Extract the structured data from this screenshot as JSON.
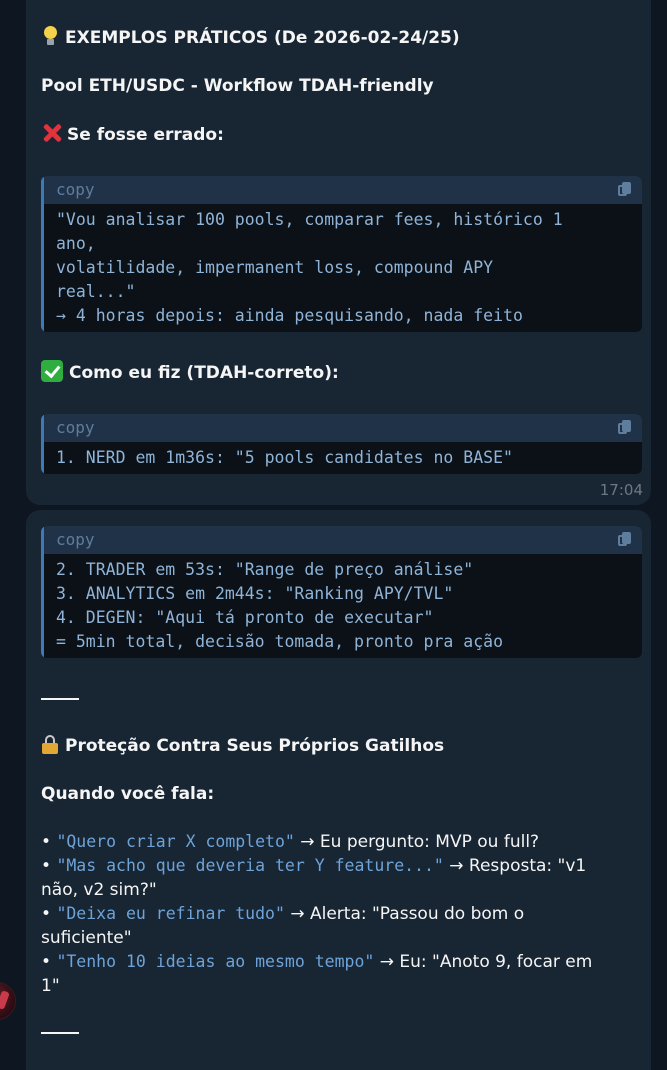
{
  "message1": {
    "heading": "EXEMPLOS PRÁTICOS (De 2026-02-24/25)",
    "heading_icon": "lightbulb-icon",
    "subtitle": "Pool ETH/USDC - Workflow TDAH-friendly",
    "wrong_label": "Se fosse errado:",
    "wrong_icon": "cross-mark-icon",
    "code1": {
      "lang": "copy",
      "lines": [
        "\"Vou analisar 100 pools, comparar fees, histórico 1",
        "ano,",
        "volatilidade, impermanent loss, compound APY",
        "real...\"",
        "→ 4 horas depois: ainda pesquisando, nada feito"
      ]
    },
    "right_label": "Como eu fiz (TDAH-correto):",
    "right_icon": "check-mark-icon",
    "code2": {
      "lang": "copy",
      "lines": [
        "1. NERD em 1m36s: \"5 pools candidates no BASE\""
      ]
    },
    "time": "17:04"
  },
  "message2": {
    "code3": {
      "lang": "copy",
      "lines": [
        "2. TRADER em 53s: \"Range de preço análise\"",
        "3. ANALYTICS em 2m44s: \"Ranking APY/TVL\"",
        "4. DEGEN: \"Aqui tá pronto de executar\"",
        "= 5min total, decisão tomada, pronto pra ação"
      ]
    },
    "section_title": "Proteção Contra Seus Próprios Gatilhos",
    "section_icon": "lock-icon",
    "when_label": "Quando você fala:",
    "bullets": [
      {
        "code": "\"Quero criar X completo\"",
        "text": " → Eu pergunto: MVP ou full?",
        "cont": ""
      },
      {
        "code": "\"Mas acho que deveria ter Y feature...\"",
        "text": " → Resposta: \"v1",
        "cont": "não, v2 sim?\""
      },
      {
        "code": "\"Deixa eu refinar tudo\"",
        "text": " → Alerta: \"Passou do bom o",
        "cont": "suficiente\""
      },
      {
        "code": "\"Tenho 10 ideias ao mesmo tempo\"",
        "text": " → Eu: \"Anoto 9, focar em",
        "cont": "1\""
      }
    ]
  }
}
